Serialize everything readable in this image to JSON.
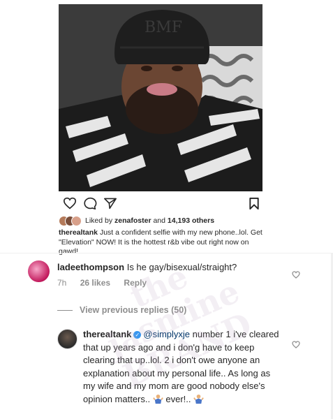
{
  "post": {
    "liked_by_prefix": "Liked by",
    "liked_by_user": "zenafoster",
    "liked_by_and": "and",
    "liked_by_others": "14,193 others",
    "caption_user": "therealtank",
    "caption_text": "Just a confident selfie with my new phone..lol. Get \"Elevation\" NOW! It is the hottest r&b vibe out right now on gawd!",
    "photo_hat_text": "BMF"
  },
  "comment1": {
    "user": "ladeethompson",
    "text": "Is he gay/bisexual/straight?",
    "time": "7h",
    "likes": "26 likes",
    "reply": "Reply"
  },
  "view_previous": "View previous replies (50)",
  "comment2": {
    "user": "therealtank",
    "mention": "@simplyxje",
    "text_a": "number 1 i've cleared that up years ago and i don'g have to keep clearing that up..lol. 2 i don't owe anyone an explanation about my personal life.. As long as my wife and my mom are good nobody else's opinion matters..",
    "text_b": "ever!.."
  },
  "watermark": "the jasmine BRAND",
  "colors": {
    "accent": "#3897f0",
    "muted": "#8e8e8e",
    "text": "#262626"
  },
  "icons": [
    "heart-icon",
    "comment-icon",
    "share-icon",
    "bookmark-icon",
    "verified-icon",
    "shrug-emoji-icon"
  ]
}
